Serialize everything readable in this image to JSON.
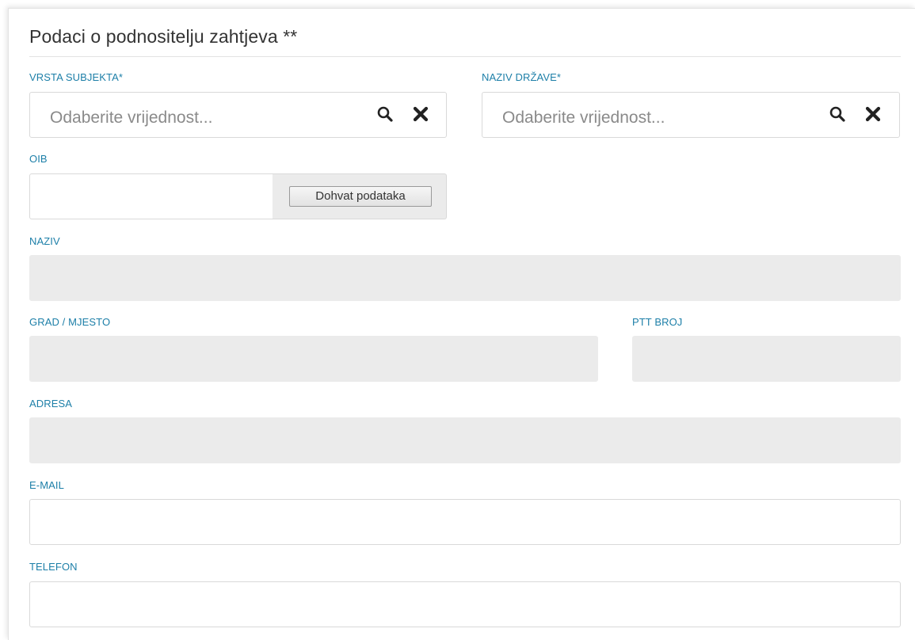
{
  "section": {
    "title": "Podaci o podnositelju zahtjeva **"
  },
  "fields": {
    "vrsta_subjekta": {
      "label": "VRSTA SUBJEKTA*",
      "placeholder": "Odaberite vrijednost...",
      "icons": [
        "search-icon",
        "clear-icon"
      ]
    },
    "naziv_drzave": {
      "label": "NAZIV DRŽAVE*",
      "placeholder": "Odaberite vrijednost...",
      "icons": [
        "search-icon",
        "clear-icon"
      ]
    },
    "oib": {
      "label": "OIB",
      "value": "",
      "button_label": "Dohvat podataka"
    },
    "naziv": {
      "label": "NAZIV",
      "value": ""
    },
    "grad_mjesto": {
      "label": "GRAD / MJESTO",
      "value": ""
    },
    "ptt_broj": {
      "label": "PTT BROJ",
      "value": ""
    },
    "adresa": {
      "label": "ADRESA",
      "value": ""
    },
    "email": {
      "label": "E-MAIL",
      "value": ""
    },
    "telefon": {
      "label": "TELEFON",
      "value": ""
    }
  },
  "colors": {
    "label": "#1d7fa8",
    "readonly_bg": "#ebebeb",
    "border": "#d9d9d9",
    "placeholder": "#8a8a8a"
  }
}
